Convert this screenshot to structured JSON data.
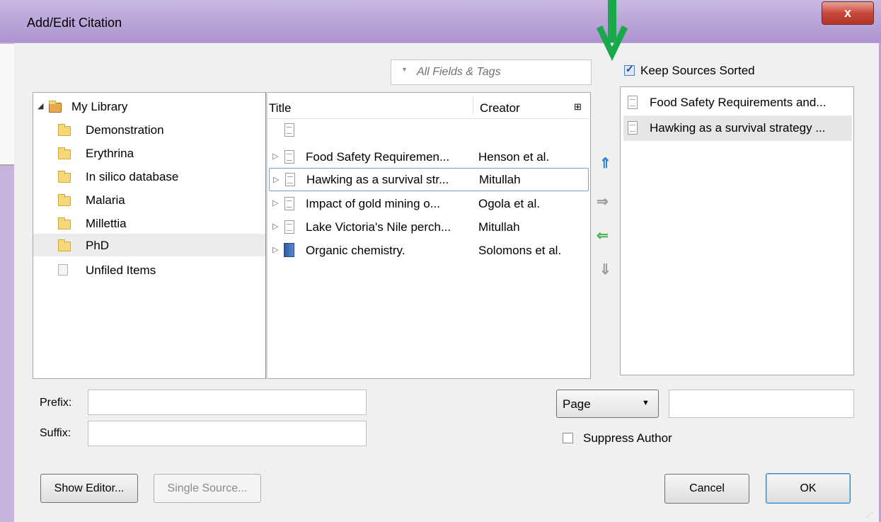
{
  "window": {
    "title": "Add/Edit Citation",
    "close_glyph": "x"
  },
  "search": {
    "placeholder": "All Fields & Tags"
  },
  "keep_sorted": {
    "label": "Keep Sources Sorted",
    "checked": true
  },
  "library": {
    "root": "My Library",
    "collections": [
      "Demonstration",
      "Erythrina",
      "In silico database",
      "Malaria",
      "Millettia",
      "PhD",
      "Unfiled Items"
    ],
    "selected": "PhD"
  },
  "items": {
    "columns": {
      "title": "Title",
      "creator": "Creator"
    },
    "rows": [
      {
        "title": "Food Safety Requiremen...",
        "creator": "Henson et al.",
        "icon": "document-icon"
      },
      {
        "title": "Hawking as a survival str...",
        "creator": "Mitullah",
        "icon": "document-icon"
      },
      {
        "title": "Impact of gold mining o...",
        "creator": "Ogola et al.",
        "icon": "document-icon"
      },
      {
        "title": "Lake Victoria's Nile perch...",
        "creator": "Mitullah",
        "icon": "document-icon"
      },
      {
        "title": "Organic chemistry.",
        "creator": "Solomons et al.",
        "icon": "book-icon"
      }
    ]
  },
  "arrows": {
    "up": "⇑",
    "right": "⇒",
    "left": "⇐",
    "down": "⇓",
    "up_color": "#2a7fd4",
    "left_color": "#4caf50",
    "gray": "#9a9a9a"
  },
  "sources": [
    {
      "title": "Food Safety Requirements and..."
    },
    {
      "title": "Hawking as a survival strategy ..."
    }
  ],
  "form": {
    "prefix_label": "Prefix:",
    "suffix_label": "Suffix:",
    "prefix_value": "",
    "suffix_value": "",
    "locator_type": "Page",
    "locator_value": "",
    "suppress_author": {
      "label": "Suppress Author",
      "checked": false
    }
  },
  "buttons": {
    "show_editor": "Show Editor...",
    "single_source": "Single Source...",
    "cancel": "Cancel",
    "ok": "OK"
  },
  "annotation": {
    "arrow_color": "#19a84a"
  }
}
